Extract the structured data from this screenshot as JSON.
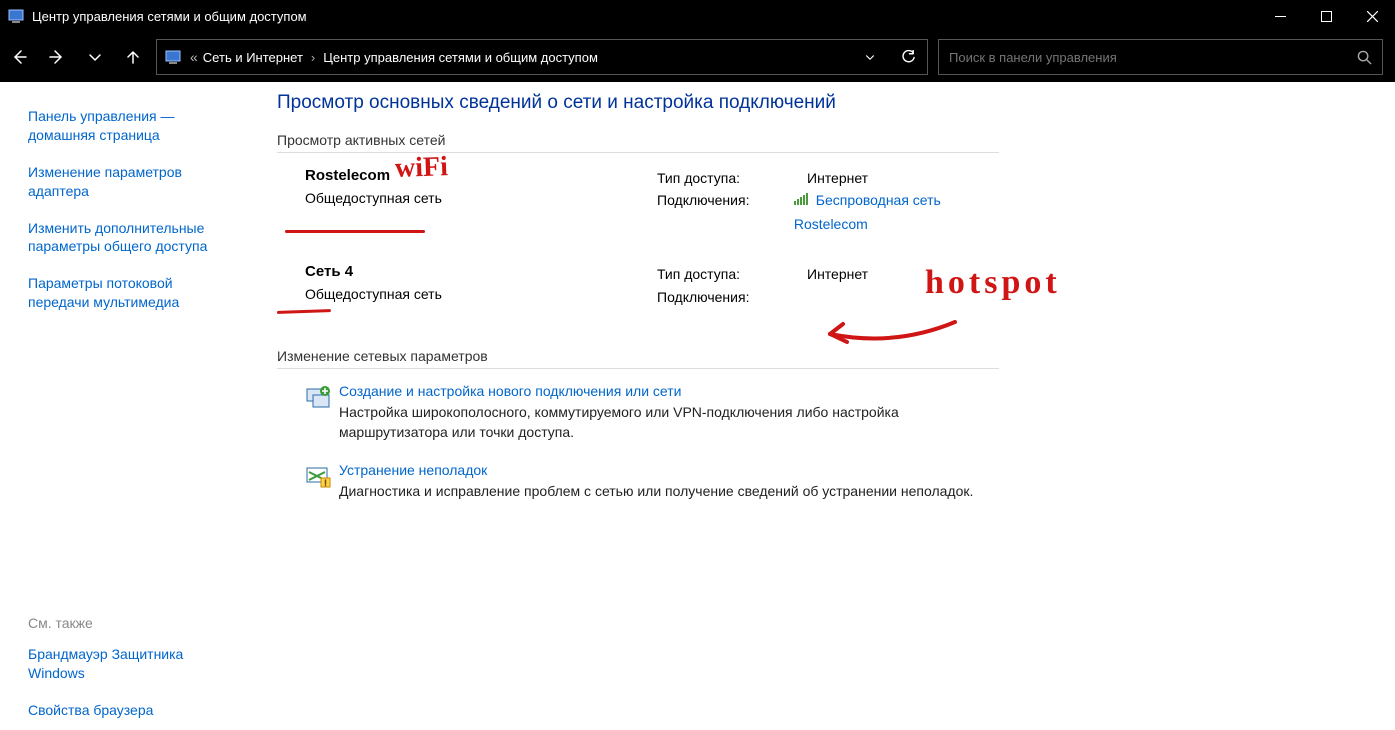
{
  "window": {
    "title": "Центр управления сетями и общим доступом"
  },
  "address": {
    "prefix_glyph": "«",
    "part1": "Сеть и Интернет",
    "part2": "Центр управления сетями и общим доступом"
  },
  "search": {
    "placeholder": "Поиск в панели управления"
  },
  "sidebar": {
    "links": [
      "Панель управления — домашняя страница",
      "Изменение параметров адаптера",
      "Изменить дополнительные параметры общего доступа",
      "Параметры потоковой передачи мультимедиа"
    ],
    "see_also_label": "См. также",
    "see_also_links": [
      "Брандмауэр Защитника Windows",
      "Свойства браузера"
    ]
  },
  "main": {
    "page_title": "Просмотр основных сведений о сети и настройка подключений",
    "active_networks_header": "Просмотр активных сетей",
    "change_settings_header": "Изменение сетевых параметров",
    "labels": {
      "access_type": "Тип доступа:",
      "connections": "Подключения:"
    },
    "networks": [
      {
        "name": "Rostelecom",
        "category": "Общедоступная сеть",
        "access": "Интернет",
        "connection_link": "Беспроводная сеть Rostelecom",
        "has_wifi_icon": true
      },
      {
        "name": "Сеть 4",
        "category": "Общедоступная сеть",
        "access": "Интернет",
        "connection_link": "",
        "has_wifi_icon": false
      }
    ],
    "options": [
      {
        "link": "Создание и настройка нового подключения или сети",
        "desc": "Настройка широкополосного, коммутируемого или VPN-подключения либо настройка маршрутизатора или точки доступа."
      },
      {
        "link": "Устранение неполадок",
        "desc": "Диагностика и исправление проблем с сетью или получение сведений об устранении неполадок."
      }
    ]
  },
  "annotations": {
    "wifi": "wiFi",
    "hotspot": "hotspot"
  }
}
